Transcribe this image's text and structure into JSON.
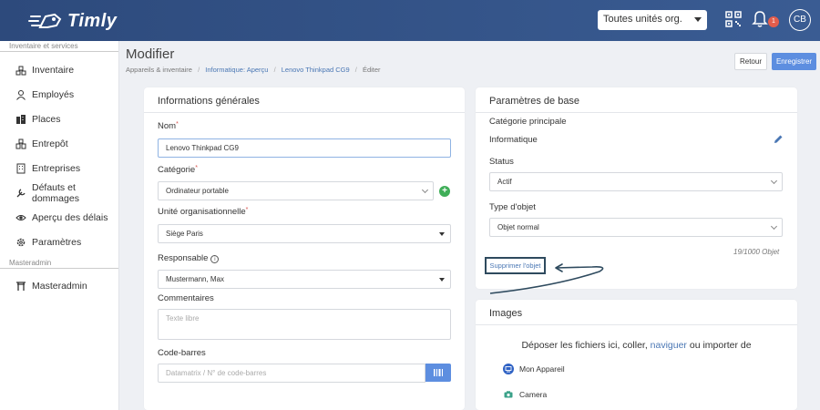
{
  "header": {
    "brand": "Timly",
    "org_select": "Toutes unités org.",
    "notifications_count": "1",
    "avatar_initials": "CB"
  },
  "sidebar": {
    "section1": "Inventaire et services",
    "items": [
      {
        "label": "Inventaire",
        "icon": "inventory-icon"
      },
      {
        "label": "Employés",
        "icon": "person-icon"
      },
      {
        "label": "Places",
        "icon": "building-icon"
      },
      {
        "label": "Entrepôt",
        "icon": "warehouse-icon"
      },
      {
        "label": "Entreprises",
        "icon": "company-icon"
      },
      {
        "label": "Défauts et dommages",
        "icon": "wrench-icon"
      },
      {
        "label": "Aperçu des délais",
        "icon": "eye-icon"
      },
      {
        "label": "Paramètres",
        "icon": "gear-icon"
      }
    ],
    "section2": "Masteradmin",
    "admin_item": {
      "label": "Masteradmin",
      "icon": "gate-icon"
    }
  },
  "page": {
    "title": "Modifier",
    "breadcrumb": [
      "Appareils & inventaire",
      "Informatique: Aperçu",
      "Lenovo Thinkpad CG9",
      "Éditer"
    ],
    "back_label": "Retour",
    "save_label": "Enregistrer"
  },
  "general": {
    "title": "Informations générales",
    "name_label": "Nom",
    "name_value": "Lenovo Thinkpad CG9",
    "category_label": "Catégorie",
    "category_value": "Ordinateur portable",
    "org_unit_label": "Unité organisationnelle",
    "org_unit_value": "Siège Paris",
    "responsible_label": "Responsable",
    "responsible_value": "Mustermann, Max",
    "comments_label": "Commentaires",
    "comments_placeholder": "Texte libre",
    "barcode_label": "Code-barres",
    "barcode_placeholder": "Datamatrix / N° de code-barres"
  },
  "basic": {
    "title": "Paramètres de base",
    "main_category_label": "Catégorie principale",
    "main_category_value": "Informatique",
    "status_label": "Status",
    "status_value": "Actif",
    "type_label": "Type d'objet",
    "type_value": "Objet normal",
    "counter": "19/1000 Objet",
    "delete_label": "Supprimer l'objet"
  },
  "images": {
    "title": "Images",
    "drop_prefix": "Déposer les fichiers ici, coller, ",
    "drop_link": "naviguer",
    "drop_suffix": " ou importer de",
    "sources": [
      "Mon Appareil",
      "Camera"
    ]
  }
}
